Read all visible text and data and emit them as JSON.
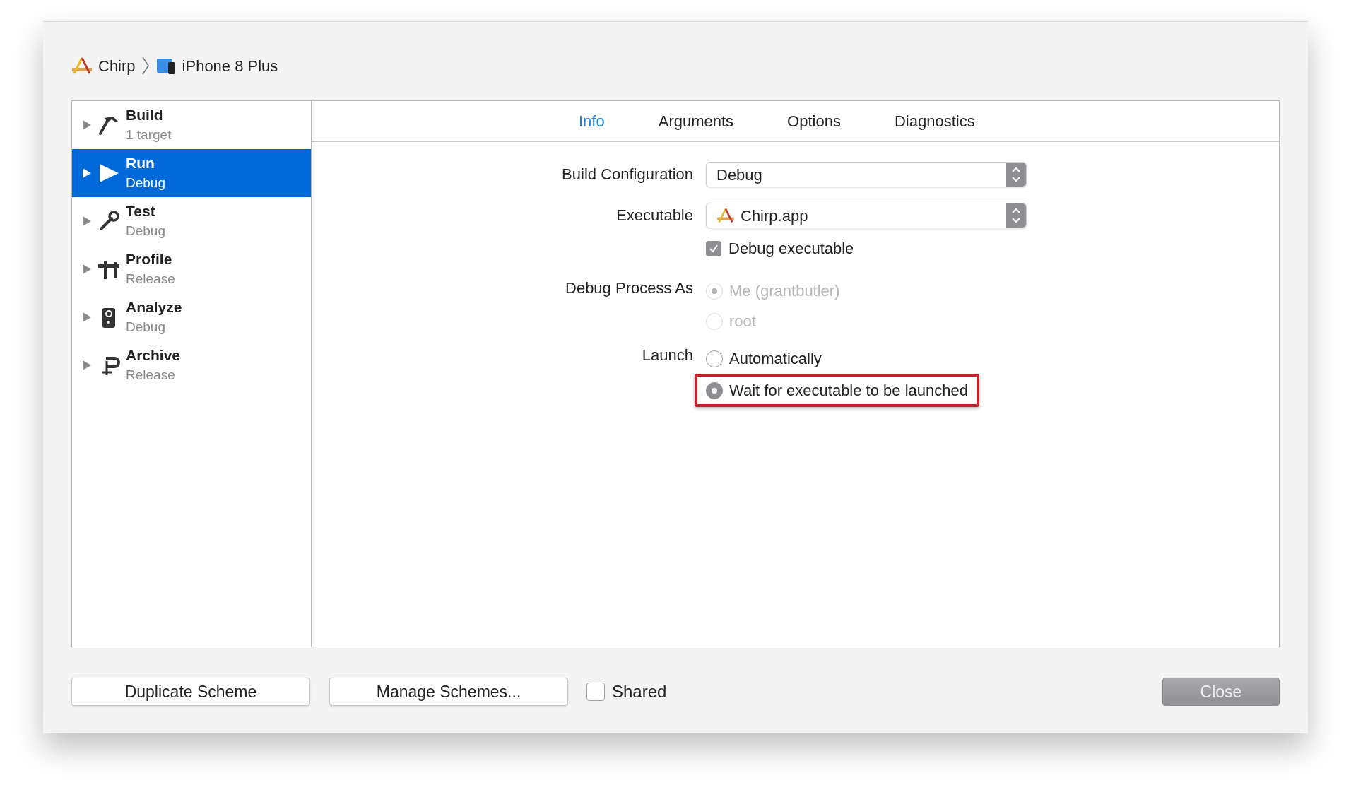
{
  "breadcrumb": [
    {
      "kind": "app",
      "label": "Chirp"
    },
    {
      "kind": "device",
      "label": "iPhone 8 Plus"
    }
  ],
  "sidebar": {
    "items": [
      {
        "kind": "build",
        "title": "Build",
        "subtitle": "1 target",
        "selected": false,
        "expanded": false
      },
      {
        "kind": "run",
        "title": "Run",
        "subtitle": "Debug",
        "selected": true,
        "expanded": false
      },
      {
        "kind": "test",
        "title": "Test",
        "subtitle": "Debug",
        "selected": false,
        "expanded": false
      },
      {
        "kind": "profile",
        "title": "Profile",
        "subtitle": "Release",
        "selected": false,
        "expanded": false
      },
      {
        "kind": "analyze",
        "title": "Analyze",
        "subtitle": "Debug",
        "selected": false,
        "expanded": false
      },
      {
        "kind": "archive",
        "title": "Archive",
        "subtitle": "Release",
        "selected": false,
        "expanded": false
      }
    ]
  },
  "tabs": [
    {
      "label": "Info",
      "selected": true
    },
    {
      "label": "Arguments",
      "selected": false
    },
    {
      "label": "Options",
      "selected": false
    },
    {
      "label": "Diagnostics",
      "selected": false
    }
  ],
  "form": {
    "build_configuration": {
      "label": "Build Configuration",
      "value": "Debug"
    },
    "executable": {
      "label": "Executable",
      "value": "Chirp.app"
    },
    "debug_executable": {
      "label": "Debug executable",
      "checked": true
    },
    "debug_process_as": {
      "label": "Debug Process As",
      "options": [
        {
          "label": "Me (grantbutler)",
          "selected": true,
          "disabled": true
        },
        {
          "label": "root",
          "selected": false,
          "disabled": true
        }
      ]
    },
    "launch": {
      "label": "Launch",
      "options": [
        {
          "label": "Automatically",
          "selected": false,
          "disabled": false,
          "highlighted": false
        },
        {
          "label": "Wait for executable to be launched",
          "selected": true,
          "disabled": false,
          "highlighted": true
        }
      ]
    }
  },
  "footer": {
    "duplicate_button": "Duplicate Scheme",
    "manage_button": "Manage Schemes...",
    "shared": {
      "label": "Shared",
      "checked": false
    },
    "close_button": "Close"
  }
}
